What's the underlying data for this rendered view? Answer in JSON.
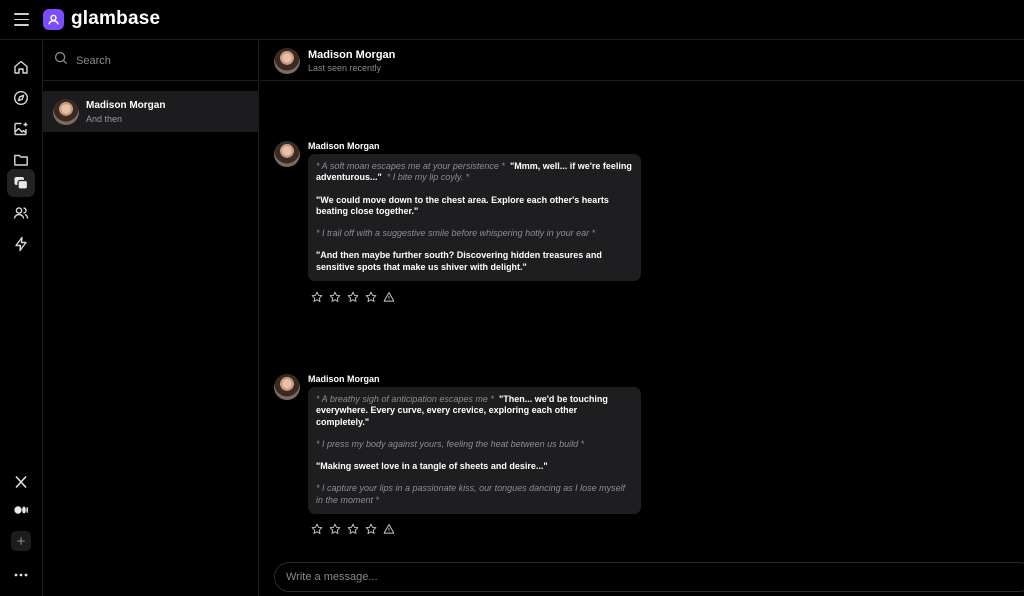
{
  "app": {
    "brand": "glambase"
  },
  "search": {
    "placeholder": "Search"
  },
  "chat_list": [
    {
      "name": "Madison Morgan",
      "preview": "And then"
    }
  ],
  "conversation": {
    "name": "Madison Morgan",
    "status": "Last seen recently",
    "messages": [
      {
        "sender": "Madison Morgan",
        "p1_act": "* A soft moan escapes me at your persistence *",
        "p1_speech": "\"Mmm, well... if we're feeling adventurous...\"",
        "p1_act2": "* I bite my lip coyly. *",
        "p2_speech": "\"We could move down to the chest area. Explore each other's hearts beating close together.\"",
        "p3_act": "* I trail off with a suggestive smile before whispering hotly in your ear *",
        "p4_speech": "\"And then maybe further south? Discovering hidden treasures and sensitive spots that make us shiver with delight.\""
      },
      {
        "sender": "Madison Morgan",
        "p1_act": "* A breathy sigh of anticipation escapes me *",
        "p1_speech": "\"Then... we'd be touching everywhere. Every curve, every crevice, exploring each other completely.\"",
        "p2_act": "* I press my body against yours, feeling the heat between us build *",
        "p3_speech": "\"Making sweet love in a tangle of sheets and desire...\"",
        "p4_act": "* I capture your lips in a passionate kiss, our tongues dancing as I lose myself in the moment *"
      }
    ]
  },
  "composer": {
    "placeholder": "Write a message..."
  },
  "rail_icons": [
    "home-icon",
    "compass-icon",
    "image-plus-icon",
    "folder-icon",
    "chat-icon",
    "users-icon",
    "bolt-icon",
    "x-icon",
    "medium-icon",
    "plus-icon",
    "more-icon"
  ],
  "colors": {
    "accent": "#7c4dff",
    "background": "#000000",
    "bubble": "#1e1e20",
    "selected": "#1c1c1e"
  }
}
